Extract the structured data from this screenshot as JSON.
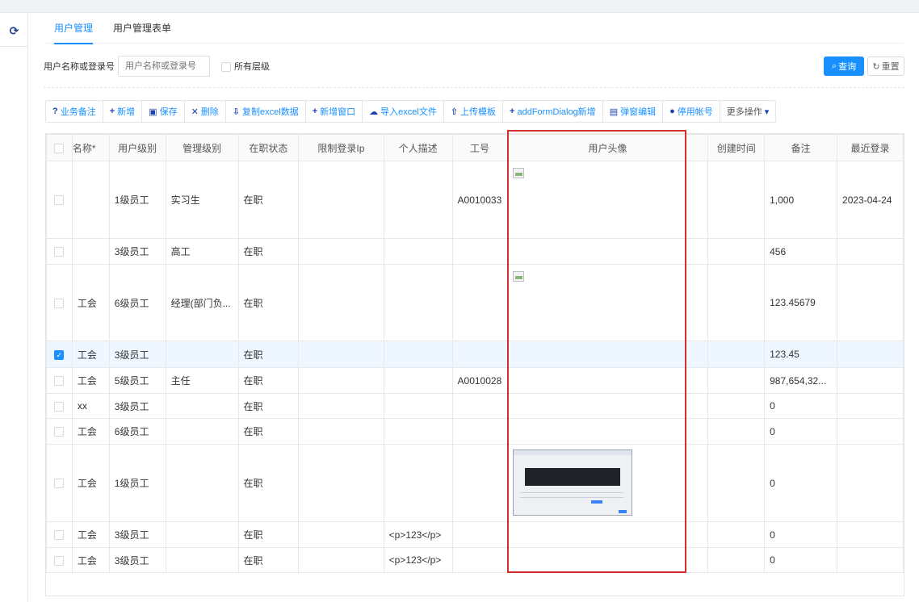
{
  "tabs": [
    {
      "label": "用户管理",
      "active": true
    },
    {
      "label": "用户管理表单",
      "active": false
    }
  ],
  "search": {
    "label": "用户名称或登录号",
    "placeholder": "用户名称或登录号",
    "all_levels_label": "所有层级",
    "query_label": "查询",
    "reset_label": "重置"
  },
  "toolbar": [
    {
      "icon": "question-circle-icon",
      "glyph": "?",
      "label": "业务备注"
    },
    {
      "icon": "plus-icon",
      "glyph": "+",
      "label": "新增"
    },
    {
      "icon": "save-icon",
      "glyph": "▣",
      "label": "保存"
    },
    {
      "icon": "delete-icon",
      "glyph": "✕",
      "label": "删除"
    },
    {
      "icon": "copy-excel-icon",
      "glyph": "⇩",
      "label": "复制excel数据"
    },
    {
      "icon": "plus-icon",
      "glyph": "+",
      "label": "新增窗口"
    },
    {
      "icon": "cloud-import-icon",
      "glyph": "☁",
      "label": "导入excel文件"
    },
    {
      "icon": "upload-icon",
      "glyph": "⇧",
      "label": "上传模板"
    },
    {
      "icon": "plus-icon",
      "glyph": "+",
      "label": "addFormDialog新增"
    },
    {
      "icon": "form-edit-icon",
      "glyph": "▤",
      "label": "弹窗编辑"
    },
    {
      "icon": "minus-circle-icon",
      "glyph": "●",
      "label": "停用帐号"
    },
    {
      "icon": "caret-down-icon",
      "glyph": "▾",
      "label": "更多操作"
    }
  ],
  "table": {
    "columns": [
      "名称*",
      "用户级别",
      "管理级别",
      "在职状态",
      "限制登录Ip",
      "个人描述",
      "工号",
      "用户头像",
      "创建时间",
      "备注",
      "最近登录"
    ],
    "rows": [
      {
        "name": "",
        "level": "1级员工",
        "mgmt": "实习生",
        "status": "在职",
        "ip": "",
        "desc": "",
        "no": "A0010033",
        "avatar": "broken",
        "created": "",
        "remark": "1,000",
        "last": "2023-04-24",
        "checked": false
      },
      {
        "name": "",
        "level": "3级员工",
        "mgmt": "高工",
        "status": "在职",
        "ip": "",
        "desc": "",
        "no": "",
        "avatar": "",
        "created": "",
        "remark": "456",
        "last": "",
        "checked": false
      },
      {
        "name": "工会",
        "level": "6级员工",
        "mgmt": "经理(部门负...",
        "status": "在职",
        "ip": "",
        "desc": "",
        "no": "",
        "avatar": "broken",
        "created": "",
        "remark": "123.45679",
        "last": "",
        "checked": false
      },
      {
        "name": "工会",
        "level": "3级员工",
        "mgmt": "",
        "status": "在职",
        "ip": "",
        "desc": "",
        "no": "",
        "avatar": "",
        "created": "",
        "remark": "123.45",
        "last": "",
        "checked": true
      },
      {
        "name": "工会",
        "level": "5级员工",
        "mgmt": "主任",
        "status": "在职",
        "ip": "",
        "desc": "",
        "no": "A0010028",
        "avatar": "",
        "created": "",
        "remark": "987,654,32...",
        "last": "",
        "checked": false
      },
      {
        "name": "xx",
        "level": "3级员工",
        "mgmt": "",
        "status": "在职",
        "ip": "",
        "desc": "",
        "no": "",
        "avatar": "",
        "created": "",
        "remark": "0",
        "last": "",
        "checked": false
      },
      {
        "name": "工会",
        "level": "6级员工",
        "mgmt": "",
        "status": "在职",
        "ip": "",
        "desc": "",
        "no": "",
        "avatar": "",
        "created": "",
        "remark": "0",
        "last": "",
        "checked": false
      },
      {
        "name": "工会",
        "level": "1级员工",
        "mgmt": "",
        "status": "在职",
        "ip": "",
        "desc": "",
        "no": "",
        "avatar": "thumbnail",
        "created": "",
        "remark": "0",
        "last": "",
        "checked": false
      },
      {
        "name": "工会",
        "level": "3级员工",
        "mgmt": "",
        "status": "在职",
        "ip": "",
        "desc": "<p>123</p>",
        "no": "",
        "avatar": "",
        "created": "",
        "remark": "0",
        "last": "",
        "checked": false
      },
      {
        "name": "工会",
        "level": "3级员工",
        "mgmt": "",
        "status": "在职",
        "ip": "",
        "desc": "<p>123</p>",
        "no": "",
        "avatar": "",
        "created": "",
        "remark": "0",
        "last": "",
        "checked": false
      }
    ]
  },
  "colors": {
    "accent": "#1890ff",
    "highlight": "#d32f2f",
    "selected_row": "#eef6ff"
  }
}
